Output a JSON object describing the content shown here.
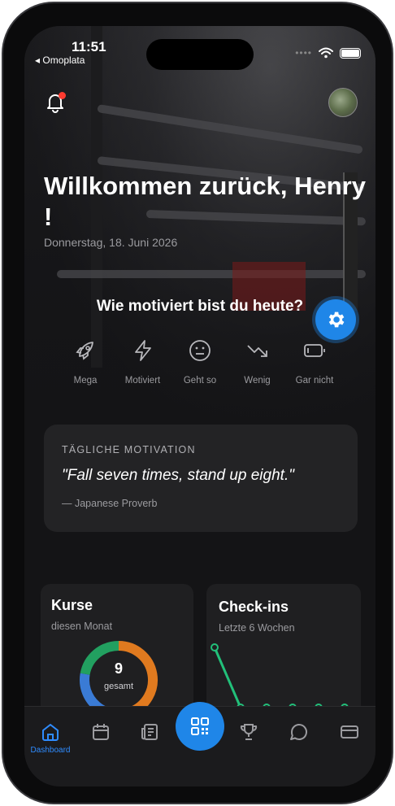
{
  "status_bar": {
    "time": "11:51",
    "back_app": "◂ Omoplata"
  },
  "header": {
    "welcome": "Willkommen zurück, Henry !",
    "date": "Donnerstag, 18. Juni 2026"
  },
  "motivation": {
    "question": "Wie motiviert bist du heute?",
    "options": [
      {
        "label": "Mega",
        "icon": "rocket-icon"
      },
      {
        "label": "Motiviert",
        "icon": "lightning-icon"
      },
      {
        "label": "Geht so",
        "icon": "neutral-face-icon"
      },
      {
        "label": "Wenig",
        "icon": "trend-down-icon"
      },
      {
        "label": "Gar nicht",
        "icon": "battery-empty-icon"
      }
    ]
  },
  "daily_quote": {
    "kicker": "TÄGLICHE MOTIVATION",
    "text": "\"Fall seven times, stand up eight.\"",
    "author": "— Japanese Proverb"
  },
  "kurse_card": {
    "title": "Kurse",
    "subtitle": "diesen Monat",
    "total": "9",
    "total_label": "gesamt"
  },
  "checkins_card": {
    "title": "Check-ins",
    "subtitle": "Letzte 6 Wochen"
  },
  "tabbar": {
    "dashboard_label": "Dashboard"
  },
  "colors": {
    "accent": "#1f86e8",
    "tab_active": "#2f8cff",
    "chart_line": "#22c07a",
    "donut_orange": "#e07a1f",
    "donut_blue": "#3a7bd5"
  },
  "chart_data": [
    {
      "type": "pie",
      "title": "Kurse",
      "values": [
        4,
        3,
        2
      ],
      "colors": [
        "#e07a1f",
        "#3a7bd5",
        "#22a060"
      ]
    },
    {
      "type": "line",
      "title": "Check-ins",
      "x": [
        1,
        2,
        3,
        4,
        5,
        6
      ],
      "series": [
        {
          "values": [
            6,
            0,
            0,
            0,
            0,
            0
          ]
        }
      ],
      "ylim": [
        0,
        6
      ]
    }
  ]
}
